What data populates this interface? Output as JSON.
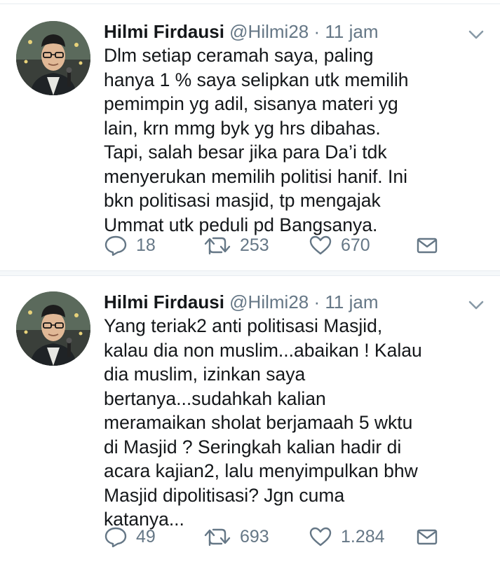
{
  "tweets": [
    {
      "author_name": "Hilmi Firdausi",
      "handle": "@Hilmi28",
      "separator": "·",
      "time": "11 jam",
      "lines": [
        "Dlm setiap ceramah saya, paling",
        "hanya 1 % saya selipkan utk memilih",
        "pemimpin yg adil, sisanya materi yg",
        "lain, krn mmg byk yg hrs dibahas.",
        "Tapi, salah besar jika para Da’i tdk",
        "menyerukan memilih politisi hanif. Ini",
        "bkn politisasi masjid, tp mengajak",
        "Ummat utk peduli pd Bangsanya."
      ],
      "replies": "18",
      "retweets": "253",
      "likes": "670"
    },
    {
      "author_name": "Hilmi Firdausi",
      "handle": "@Hilmi28",
      "separator": "·",
      "time": "11 jam",
      "lines": [
        "Yang teriak2 anti politisasi Masjid,",
        "kalau dia non muslim...abaikan ! Kalau",
        "dia muslim, izinkan saya",
        "bertanya...sudahkah kalian",
        "meramaikan sholat berjamaah 5 wktu",
        "di Masjid ? Seringkah kalian hadir di",
        "acara kajian2, lalu menyimpulkan bhw",
        "Masjid dipolitisasi? Jgn cuma",
        "katanya..."
      ],
      "replies": "49",
      "retweets": "693",
      "likes": "1.284"
    }
  ],
  "colors": {
    "text": "#14171a",
    "secondary": "#657786",
    "divider": "#e6ecf0",
    "background": "#ffffff"
  },
  "icons": {
    "reply": "reply-icon",
    "retweet": "retweet-icon",
    "like": "heart-icon",
    "message": "envelope-icon",
    "menu": "chevron-down-icon"
  }
}
